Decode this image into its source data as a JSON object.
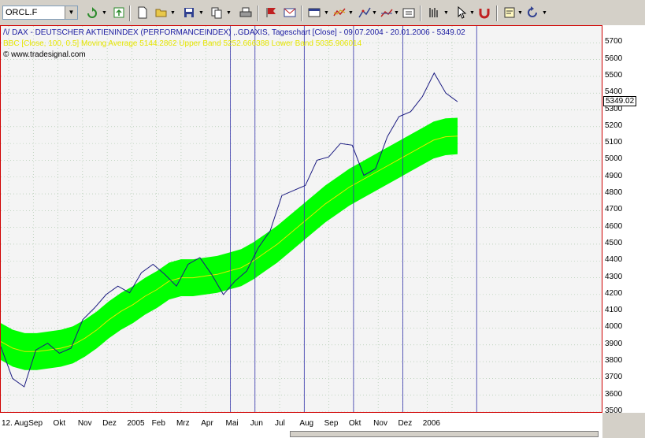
{
  "toolbar": {
    "symbol": "ORCL.F",
    "icons": [
      "refresh-icon",
      "reload-icon",
      "new-doc-icon",
      "open-folder-icon",
      "save-icon",
      "copy-icon",
      "print-icon",
      "flag-icon",
      "mail-flag-icon",
      "window-icon",
      "indicator-icon",
      "drawing-icon",
      "trend-icon",
      "properties-icon",
      "bars-icon",
      "cursor-icon",
      "magnet-icon",
      "note-icon",
      "undo-icon"
    ]
  },
  "chart": {
    "header_line1": "DAX - DEUTSCHER AKTIENINDEX (PERFORMANCEINDEX) ,.GDAXIS, Tageschart [Close] - 09.07.2004 - 20.01.2006 - 5349.02",
    "header_line2_label": "BBC [Close, 100, 0.5]",
    "header_line2": "Moving Average 5144.2862 Upper Band 5252.666388 Lower Band 5035.906014",
    "header_line3": "© www.tradesignal.com",
    "last_value": "5349.02",
    "colors": {
      "price": "#1a1a80",
      "band": "#00ff00",
      "ma": "#e6e600",
      "vline": "#3333aa",
      "grid": "#a0c0a0"
    }
  },
  "chart_data": {
    "type": "line",
    "title": "DAX - DEUTSCHER AKTIENINDEX (PERFORMANCEINDEX) ,.GDAXIS, Tageschart [Close] - 09.07.2004 - 20.01.2006 - 5349.02",
    "ylim": [
      3500,
      5800
    ],
    "y_ticks": [
      "5700",
      "5600",
      "5500",
      "5400",
      "5300",
      "5200",
      "5100",
      "5000",
      "4900",
      "4800",
      "4700",
      "4600",
      "4500",
      "4400",
      "4300",
      "4200",
      "4100",
      "4000",
      "3900",
      "3800",
      "3700",
      "3600",
      "3500"
    ],
    "x_ticks": [
      "12. Aug",
      "Sep",
      "Okt",
      "Nov",
      "Dez",
      "2005",
      "Feb",
      "Mrz",
      "Apr",
      "Mai",
      "Jun",
      "Jul",
      "Aug",
      "Sep",
      "Okt",
      "Nov",
      "Dez",
      "2006"
    ],
    "x_months": [
      "2004-07",
      "2004-08",
      "2004-09",
      "2004-10",
      "2004-11",
      "2004-12",
      "2005-01",
      "2005-02",
      "2005-03",
      "2005-04",
      "2005-05",
      "2005-06",
      "2005-07",
      "2005-08",
      "2005-09",
      "2005-10",
      "2005-11",
      "2005-12",
      "2006-01"
    ],
    "series": [
      {
        "values": [
          3890,
          3700,
          3650,
          3870,
          3910,
          3850,
          3880,
          4050,
          4120,
          4200,
          4250,
          4210,
          4330,
          4380,
          4320,
          4250,
          4380,
          4420,
          4320,
          4200,
          4280,
          4340,
          4480,
          4580,
          4790,
          4820,
          4850,
          5000,
          5020,
          5100,
          5090,
          4910,
          4950,
          5140,
          5260,
          5290,
          5380,
          5520,
          5400,
          5349
        ]
      },
      {
        "name": "Moving Average",
        "values": [
          3920,
          3880,
          3860,
          3860,
          3870,
          3880,
          3900,
          3940,
          3990,
          4050,
          4100,
          4140,
          4190,
          4230,
          4280,
          4300,
          4300,
          4310,
          4320,
          4340,
          4360,
          4400,
          4450,
          4500,
          4560,
          4620,
          4680,
          4740,
          4790,
          4840,
          4880,
          4920,
          4960,
          5000,
          5040,
          5080,
          5120,
          5140,
          5144
        ]
      },
      {
        "name": "Upper Band",
        "values": [
          4030,
          3990,
          3970,
          3970,
          3980,
          3990,
          4010,
          4050,
          4100,
          4160,
          4210,
          4250,
          4300,
          4340,
          4390,
          4410,
          4410,
          4420,
          4430,
          4450,
          4470,
          4510,
          4560,
          4610,
          4670,
          4730,
          4790,
          4850,
          4900,
          4950,
          4990,
          5030,
          5070,
          5110,
          5150,
          5190,
          5230,
          5250,
          5253
        ]
      },
      {
        "name": "Lower Band",
        "values": [
          3810,
          3770,
          3750,
          3750,
          3760,
          3770,
          3790,
          3830,
          3880,
          3940,
          3990,
          4030,
          4080,
          4120,
          4170,
          4190,
          4190,
          4200,
          4210,
          4230,
          4250,
          4290,
          4340,
          4390,
          4450,
          4510,
          4570,
          4630,
          4680,
          4730,
          4770,
          4810,
          4850,
          4890,
          4930,
          4970,
          5010,
          5030,
          5036
        ]
      }
    ],
    "grid": true,
    "vertical_markers": [
      "2005-04",
      "2005-05",
      "2005-07",
      "2005-09",
      "2005-11",
      "2006-02"
    ]
  }
}
